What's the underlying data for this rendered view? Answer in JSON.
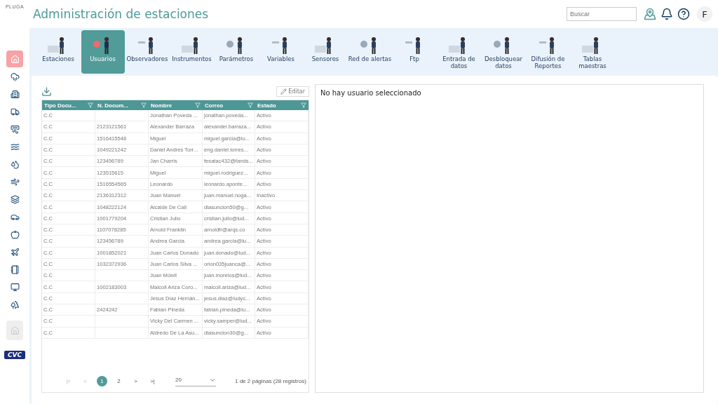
{
  "logo": "PLUGA",
  "title": "Administración de estaciones",
  "search": {
    "placeholder": "Buscar"
  },
  "avatar": "F",
  "sidebar": {
    "items": [
      {
        "selected": true,
        "disabled": false
      },
      {
        "selected": false,
        "disabled": false
      },
      {
        "selected": false,
        "disabled": false
      },
      {
        "selected": false,
        "disabled": false
      },
      {
        "selected": false,
        "disabled": false
      },
      {
        "selected": false,
        "disabled": false
      },
      {
        "selected": false,
        "disabled": false
      },
      {
        "selected": false,
        "disabled": false
      },
      {
        "selected": false,
        "disabled": false
      },
      {
        "selected": false,
        "disabled": false
      },
      {
        "selected": false,
        "disabled": false
      },
      {
        "selected": false,
        "disabled": false
      },
      {
        "selected": false,
        "disabled": false
      },
      {
        "selected": false,
        "disabled": false
      },
      {
        "selected": false,
        "disabled": false
      },
      {
        "selected": false,
        "disabled": true
      }
    ],
    "footer_logo": "CVC"
  },
  "tabs": [
    {
      "label": "Estaciones",
      "selected": false
    },
    {
      "label": "Usuarios",
      "selected": true
    },
    {
      "label": "Observadores",
      "selected": false
    },
    {
      "label": "Instrumentos",
      "selected": false
    },
    {
      "label": "Parámetros",
      "selected": false
    },
    {
      "label": "Variables",
      "selected": false
    },
    {
      "label": "Sensores",
      "selected": false
    },
    {
      "label": "Red de alertas",
      "selected": false
    },
    {
      "label": "Ftp",
      "selected": false
    },
    {
      "label": "Entrada de datos",
      "selected": false
    },
    {
      "label": "Desbloquear datos",
      "selected": false
    },
    {
      "label": "Difusión de Reportes",
      "selected": false
    },
    {
      "label": "Tablas maestras",
      "selected": false
    }
  ],
  "edit_button": "Editar",
  "table": {
    "columns": [
      "Tipo Docu...",
      "N. Docum...",
      "Nombre",
      "Correo",
      "Estado"
    ],
    "rows": [
      [
        "C.C",
        "",
        "Jonathan Poveda ...",
        "jonathan.poveda...",
        "Activo"
      ],
      [
        "C.C",
        "2123121561",
        "Alexander Barraza",
        "alexander.barraza...",
        "Activo"
      ],
      [
        "C.C",
        "1516415548",
        "Miguel",
        "miguel.garcia@lu...",
        "Activo"
      ],
      [
        "C.C",
        "1049221242",
        "Daniel Andres Torr...",
        "eng.daniel.torres...",
        "Activo"
      ],
      [
        "C.C",
        "123456789",
        "Jan Charris",
        "fesatac432@fands...",
        "Activo"
      ],
      [
        "C.C",
        "123515615",
        "Miguel",
        "miguel.rodriguez...",
        "Activo"
      ],
      [
        "C.C",
        "1516554565",
        "Leonardo",
        "leonardo.aponte...",
        "Activo"
      ],
      [
        "C.C",
        "2136312312",
        "Juan Manuel",
        "juan-manuel.noga...",
        "Inactivo"
      ],
      [
        "C.C",
        "1048222124",
        "Alcalde De Cali",
        "dlasuncion50@g...",
        "Activo"
      ],
      [
        "C.C",
        "1001779204",
        "Cristian Julio",
        "cristian.julio@lud...",
        "Activo"
      ],
      [
        "C.C",
        "1107078285",
        "Arnold Franklin",
        "arnoldfr@arqs.co",
        "Activo"
      ],
      [
        "C.C",
        "123456789",
        "Andrea Garcia",
        "andrea.garcia@lu...",
        "Activo"
      ],
      [
        "C.C",
        "1001852021",
        "Juan Carlos Donado",
        "juan.donado@lud...",
        "Activo"
      ],
      [
        "C.C",
        "1032372936",
        "Juan Carlos Silva ...",
        "orion035juanca@...",
        "Activo"
      ],
      [
        "C.C",
        "",
        "Juan Móivil",
        "juan.morelos@lud...",
        "Activo"
      ],
      [
        "C.C",
        "1002183003",
        "Maicoll Ariza Coro...",
        "maicoll.ariza@lud...",
        "Activo"
      ],
      [
        "C.C",
        "",
        "Jesus Díaz Hernán...",
        "jesus.diaz@ludyc...",
        "Activo"
      ],
      [
        "C.C",
        "2424242",
        "Fabian Pineda",
        "fabian.pineda@lu...",
        "Activo"
      ],
      [
        "C.C",
        "",
        "Vicky Del Carmen ...",
        "vicky.samper@lud...",
        "Activo"
      ],
      [
        "C.C",
        "",
        "Aldredo De La Asu...",
        "dlasuncion30@g...",
        "Activo"
      ]
    ]
  },
  "pagination": {
    "first": "|<",
    "prev": "<",
    "pages": [
      {
        "label": "1",
        "selected": true
      },
      {
        "label": "2",
        "selected": false
      }
    ],
    "next": ">",
    "last": ">|",
    "page_size": "20",
    "summary": "1 de 2 páginas (28 registros)"
  },
  "detail": {
    "message": "No hay usuario seleccionado"
  }
}
